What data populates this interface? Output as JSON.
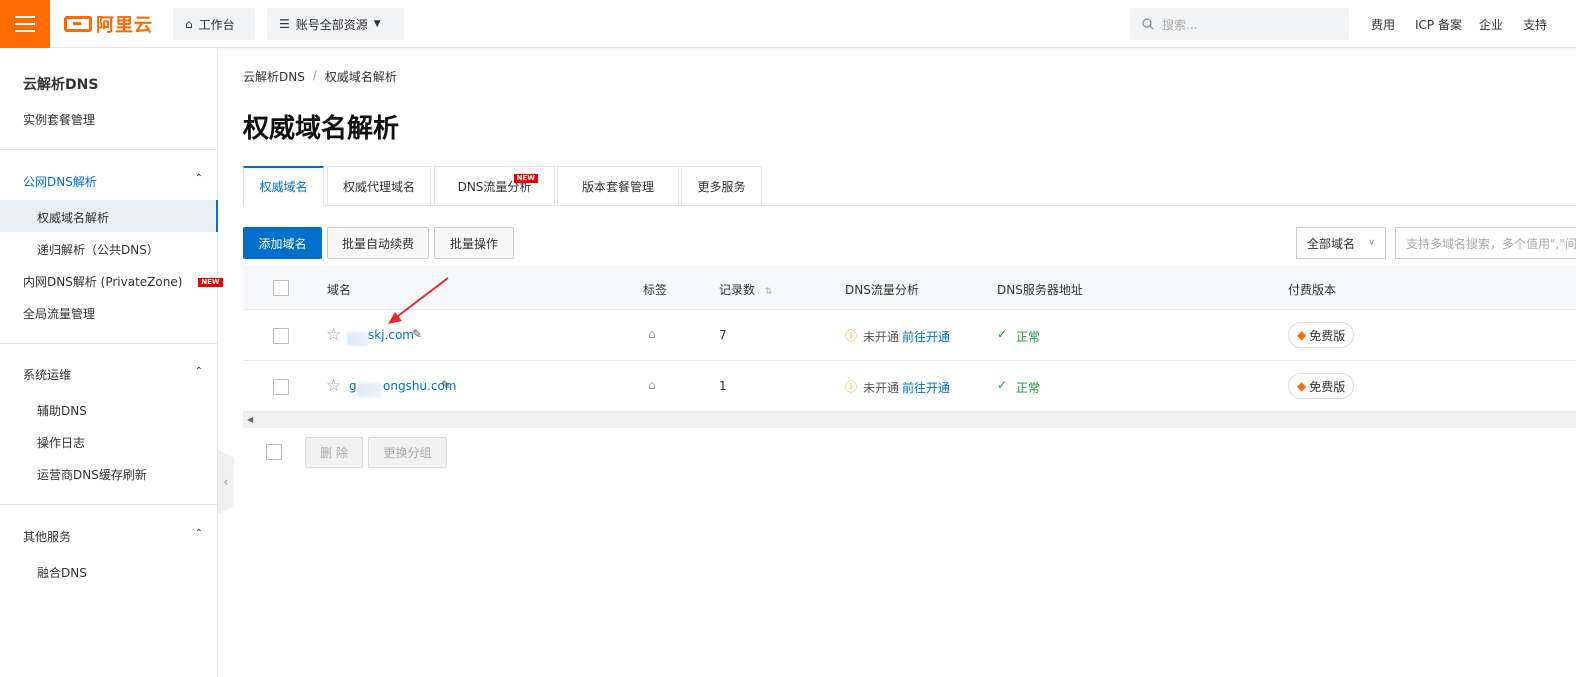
{
  "topbar": {
    "logo_text": "阿里云",
    "workbench": "工作台",
    "resources": "账号全部资源",
    "search_placeholder": "搜索...",
    "links": [
      "费用",
      "ICP 备案",
      "企业",
      "支持"
    ],
    "brand_color": "#ff6a00"
  },
  "sidebar": {
    "title": "云解析DNS",
    "instance": "实例套餐管理",
    "groups": {
      "public": "公网DNS解析",
      "ops": "系统运维",
      "other": "其他服务"
    },
    "items": {
      "authoritative": "权威域名解析",
      "recursive": "递归解析（公共DNS）",
      "privatezone": "内网DNS解析 (PrivateZone)",
      "traffic": "全局流量管理",
      "aux_dns": "辅助DNS",
      "oplog": "操作日志",
      "cache_refresh": "运营商DNS缓存刷新",
      "fusion": "融合DNS"
    },
    "new_badge": "NEW"
  },
  "breadcrumb": [
    "云解析DNS",
    "权威域名解析"
  ],
  "page_title": "权威域名解析",
  "tabs": [
    {
      "label": "权威域名",
      "active": true
    },
    {
      "label": "权威代理域名"
    },
    {
      "label": "DNS流量分析",
      "badge": "NEW"
    },
    {
      "label": "版本套餐管理"
    },
    {
      "label": "更多服务"
    }
  ],
  "toolbar": {
    "add": "添加域名",
    "auto_renew": "批量自动续费",
    "batch": "批量操作",
    "filter": "全部域名",
    "search_placeholder": "支持多域名搜索，多个值用\",\"间"
  },
  "table": {
    "headers": [
      "域名",
      "标签",
      "记录数",
      "DNS流量分析",
      "DNS服务器地址",
      "付费版本"
    ],
    "rows": [
      {
        "domain": "skj.com",
        "records": "7",
        "traffic_status": "未开通",
        "traffic_link": "前往开通",
        "server_status": "正常",
        "plan": "免费版"
      },
      {
        "domain": "ongshu.com",
        "domain_prefix": "g",
        "records": "1",
        "traffic_status": "未开通",
        "traffic_link": "前往开通",
        "server_status": "正常",
        "plan": "免费版"
      }
    ]
  },
  "footer": {
    "delete": "删 除",
    "change_group": "更换分组"
  },
  "colors": {
    "accent": "#0070cc",
    "warning": "#e6a700",
    "success": "#1a9a3c",
    "badge_red": "#e00"
  }
}
